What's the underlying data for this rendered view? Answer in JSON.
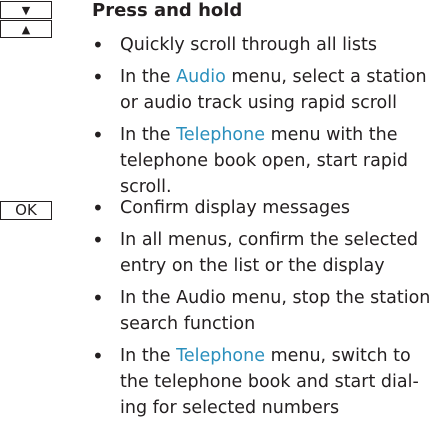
{
  "buttons": {
    "down_glyph": "▼",
    "up_glyph": "▲",
    "up_pointer_glyph": "◀",
    "ok_label": "OK"
  },
  "section_hold": {
    "heading": "Press and hold",
    "items": [
      {
        "parts": [
          "Quickly scroll through all lists"
        ]
      },
      {
        "parts": [
          "In the ",
          "Audio",
          " menu, select a station or audio track using rapid scroll"
        ]
      },
      {
        "parts": [
          "In the ",
          "Telephone",
          " menu with the telephone book open, start rapid scroll."
        ]
      }
    ]
  },
  "section_ok": {
    "items": [
      {
        "parts": [
          "Confirm display messages"
        ]
      },
      {
        "parts": [
          "In all menus, confirm the selected entry on the list or the display"
        ]
      },
      {
        "parts": [
          "In the Audio menu, stop the station search function"
        ]
      },
      {
        "parts": [
          "In the ",
          "Telephone",
          " menu, switch to the telephone book and start dial-ing for selected numbers"
        ]
      }
    ]
  },
  "colors": {
    "text": "#231f20",
    "highlight": "#2a8fbd"
  }
}
